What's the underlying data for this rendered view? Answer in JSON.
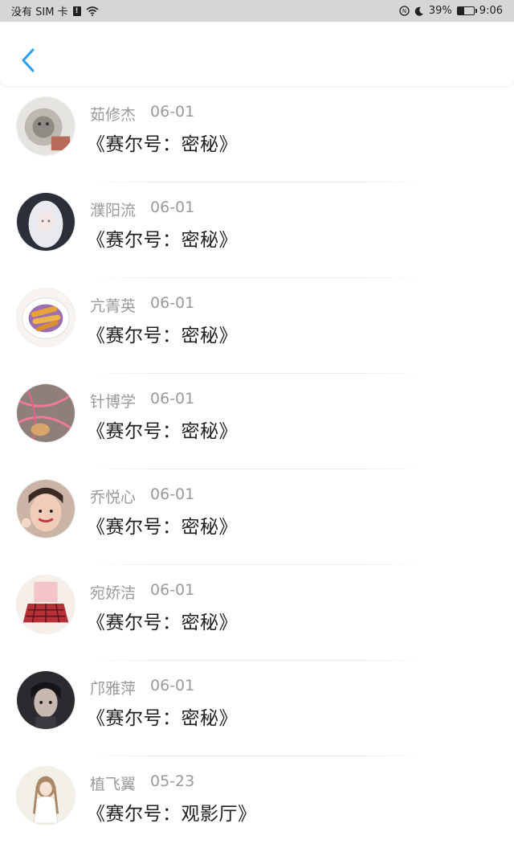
{
  "status_bar": {
    "carrier": "没有 SIM 卡",
    "sim_icon": "sim-alert-icon",
    "wifi_icon": "wifi-icon",
    "nfc_icon": "nfc-icon",
    "moon_icon": "moon-icon",
    "battery_percent": "39%",
    "battery_level": 0.39,
    "time": "9:06"
  },
  "header": {
    "back_icon": "chevron-left-icon",
    "accent": "#2a9ef0"
  },
  "items": [
    {
      "name": "茹修杰",
      "date": "06-01",
      "title": "《赛尔号：密秘》"
    },
    {
      "name": "濮阳流",
      "date": "06-01",
      "title": "《赛尔号：密秘》"
    },
    {
      "name": "亢菁英",
      "date": "06-01",
      "title": "《赛尔号：密秘》"
    },
    {
      "name": "针博学",
      "date": "06-01",
      "title": "《赛尔号：密秘》"
    },
    {
      "name": "乔悦心",
      "date": "06-01",
      "title": "《赛尔号：密秘》"
    },
    {
      "name": "宛娇洁",
      "date": "06-01",
      "title": "《赛尔号：密秘》"
    },
    {
      "name": "邝雅萍",
      "date": "06-01",
      "title": "《赛尔号：密秘》"
    },
    {
      "name": "植飞翼",
      "date": "05-23",
      "title": "《赛尔号：观影厅》"
    }
  ]
}
